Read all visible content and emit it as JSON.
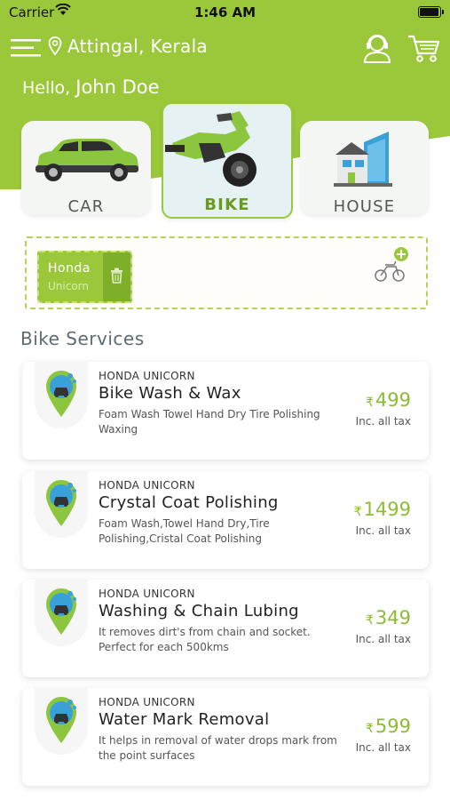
{
  "status": {
    "carrier": "Carrier",
    "time": "1:46 AM"
  },
  "header": {
    "location": "Attingal, Kerala",
    "greeting_prefix": "Hello,",
    "user_name": "John Doe",
    "icons": [
      "menu-icon",
      "location-pin-icon",
      "support-agent-icon",
      "cart-icon"
    ]
  },
  "categories": [
    {
      "label": "CAR",
      "selected": false
    },
    {
      "label": "BIKE",
      "selected": true
    },
    {
      "label": "HOUSE",
      "selected": false
    }
  ],
  "vehicle": {
    "name": "Honda",
    "model": "Unicorn"
  },
  "section_title": "Bike Services",
  "services": [
    {
      "brand": "HONDA UNICORN",
      "title": "Bike Wash & Wax",
      "desc": "Foam Wash  Towel Hand Dry Tire Polishing Waxing",
      "currency": "₹",
      "price": "499",
      "tax": "Inc. all tax"
    },
    {
      "brand": "HONDA UNICORN",
      "title": "Crystal Coat Polishing",
      "desc": "Foam Wash,Towel Hand Dry,Tire Polishing,Cristal Coat Polishing",
      "currency": "₹",
      "price": "1499",
      "tax": "Inc. all tax"
    },
    {
      "brand": "HONDA UNICORN",
      "title": "Washing & Chain Lubing",
      "desc": "It removes dirt's from chain and socket. Perfect for each 500kms",
      "currency": "₹",
      "price": "349",
      "tax": "Inc. all tax"
    },
    {
      "brand": "HONDA UNICORN",
      "title": "Water Mark Removal",
      "desc": "It helps in removal of water drops mark from the point surfaces",
      "currency": "₹",
      "price": "599",
      "tax": "Inc. all tax"
    }
  ],
  "colors": {
    "brand_green": "#9ac83a",
    "dark_green": "#7fae28",
    "price_green": "#8cbb34",
    "blue": "#3aa0d8"
  }
}
